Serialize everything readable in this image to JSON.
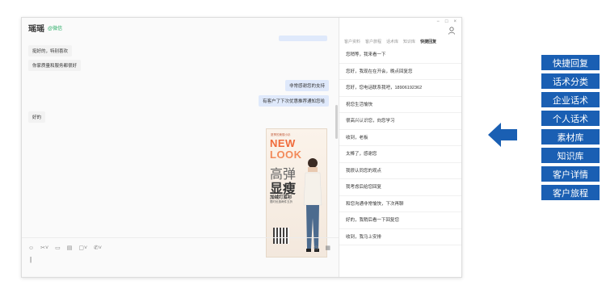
{
  "chat": {
    "title": "瑶瑶",
    "tag": "@微信",
    "messages": [
      {
        "text": "挺好的，特别喜欢",
        "side": "left"
      },
      {
        "text": "你家质量和服务都很好",
        "side": "left"
      },
      {
        "text": "非常感谢您的支持",
        "side": "right"
      },
      {
        "text": "有客户了下次优惠推荐通知您哈",
        "side": "right"
      },
      {
        "text": "好的",
        "side": "left"
      }
    ],
    "poster": {
      "small_text": "夏季的美丽小衫",
      "new": "NEW",
      "look": "LOOK",
      "line1": "高弹",
      "line2": "显瘦",
      "line3": "加绒打底衫",
      "line4": "限时优惠两件五折"
    }
  },
  "input": {
    "icons": [
      "smiley-icon",
      "scissors-icon",
      "image-icon",
      "file-icon",
      "folder-icon",
      "phone-icon"
    ],
    "cursor": "|"
  },
  "panel": {
    "controls": [
      "−",
      "□",
      "×"
    ],
    "tabs": [
      "客户资料",
      "客户旅程",
      "话术库",
      "知识库",
      "快捷回复"
    ],
    "active_tab_index": 4,
    "replies": [
      "您稍等，我来看一下",
      "您好，我现在在开会，晚点回复您",
      "您好，您电话联系我吧，18906192362",
      "祝您生活愉快",
      "很高兴认识您，向您学习",
      "收到，老板",
      "太棒了，感谢您",
      "我很认同您的观点",
      "我考虑后给您回复",
      "和您沟通非常愉快，下次再聊",
      "好的，我稍后看一下回复您",
      "收到，我马上安排"
    ]
  },
  "features": [
    "快捷回复",
    "话术分类",
    "企业话术",
    "个人话术",
    "素材库",
    "知识库",
    "客户详情",
    "客户旅程"
  ],
  "colors": {
    "feature_bg": "#1a5fb3",
    "arrow": "#1a5fb3",
    "right_bubble": "#dfe9fb"
  }
}
